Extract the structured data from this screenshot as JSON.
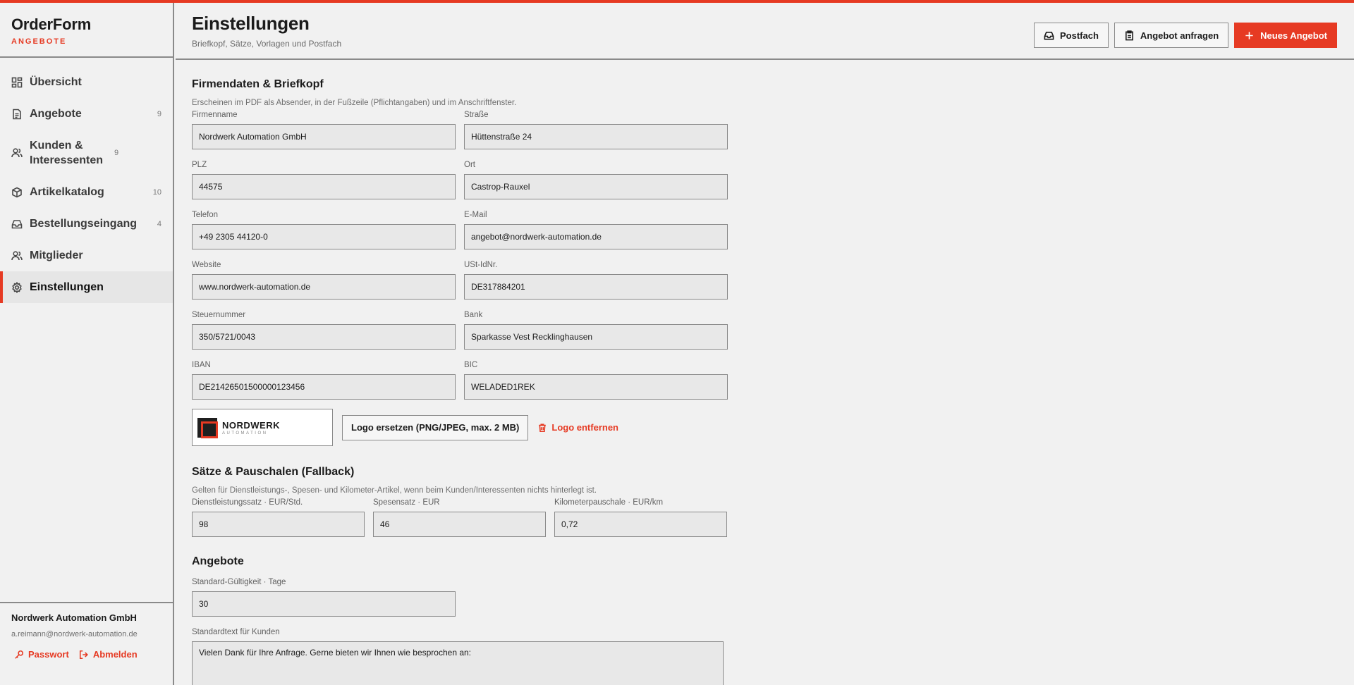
{
  "app": {
    "name": "OrderForm",
    "subtitle": "ANGEBOTE",
    "accent_color": "#e63a23"
  },
  "sidebar": {
    "items": [
      {
        "label": "Übersicht",
        "count": "",
        "icon": "dashboard-icon"
      },
      {
        "label": "Angebote",
        "count": "9",
        "icon": "document-icon"
      },
      {
        "label": "Kunden & Interessenten",
        "count": "9",
        "icon": "users-icon"
      },
      {
        "label": "Artikelkatalog",
        "count": "10",
        "icon": "box-icon"
      },
      {
        "label": "Bestellungseingang",
        "count": "4",
        "icon": "inbox-icon"
      },
      {
        "label": "Mitglieder",
        "count": "",
        "icon": "users-icon"
      },
      {
        "label": "Einstellungen",
        "count": "",
        "icon": "gear-icon",
        "active": true
      }
    ],
    "footer": {
      "company": "Nordwerk Automation GmbH",
      "email": "a.reimann@nordwerk-automation.de",
      "password_label": "Passwort",
      "logout_label": "Abmelden"
    }
  },
  "header": {
    "title": "Einstellungen",
    "subtitle": "Briefkopf, Sätze, Vorlagen und Postfach",
    "actions": {
      "postfach": "Postfach",
      "request": "Angebot anfragen",
      "new_offer": "Neues Angebot"
    }
  },
  "company": {
    "title": "Firmendaten & Briefkopf",
    "desc": "Erscheinen im PDF als Absender, in der Fußzeile (Pflichtangaben) und im Anschriftfenster.",
    "fields": [
      {
        "label": "Firmenname",
        "value": "Nordwerk Automation GmbH"
      },
      {
        "label": "Straße",
        "value": "Hüttenstraße 24"
      },
      {
        "label": "PLZ",
        "value": "44575"
      },
      {
        "label": "Ort",
        "value": "Castrop-Rauxel"
      },
      {
        "label": "Telefon",
        "value": "+49 2305 44120-0"
      },
      {
        "label": "E-Mail",
        "value": "angebot@nordwerk-automation.de"
      },
      {
        "label": "Website",
        "value": "www.nordwerk-automation.de"
      },
      {
        "label": "USt-IdNr.",
        "value": "DE317884201"
      },
      {
        "label": "Steuernummer",
        "value": "350/5721/0043"
      },
      {
        "label": "Bank",
        "value": "Sparkasse Vest Recklinghausen"
      },
      {
        "label": "IBAN",
        "value": "DE21426501500000123456"
      },
      {
        "label": "BIC",
        "value": "WELADED1REK"
      }
    ],
    "logo": {
      "name": "NORDWERK",
      "sub": "AUTOMATION",
      "replace_label": "Logo ersetzen (PNG/JPEG, max. 2 MB)",
      "remove_label": "Logo entfernen"
    }
  },
  "rates": {
    "title": "Sätze & Pauschalen (Fallback)",
    "desc": "Gelten für Dienstleistungs-, Spesen- und Kilometer-Artikel, wenn beim Kunden/Interessenten nichts hinterlegt ist.",
    "fields": [
      {
        "label": "Dienstleistungssatz · EUR/Std.",
        "value": "98"
      },
      {
        "label": "Spesensatz · EUR",
        "value": "46"
      },
      {
        "label": "Kilometerpauschale · EUR/km",
        "value": "0,72"
      }
    ]
  },
  "offers": {
    "title": "Angebote",
    "validity_label": "Standard-Gültigkeit · Tage",
    "validity_value": "30",
    "text_label": "Standardtext für Kunden",
    "text_value": "Vielen Dank für Ihre Anfrage. Gerne bieten wir Ihnen wie besprochen an:"
  }
}
